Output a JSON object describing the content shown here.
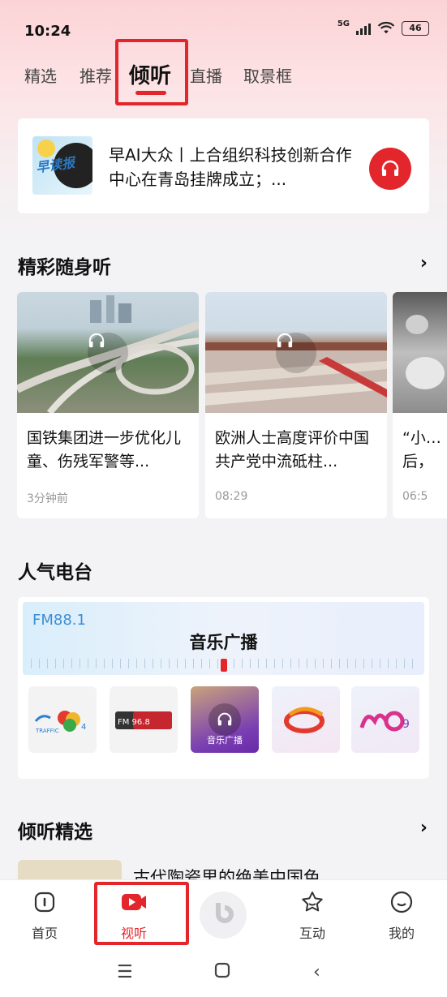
{
  "status": {
    "time": "10:24",
    "network": "5G",
    "battery": "46"
  },
  "tabs": [
    {
      "label": "精选"
    },
    {
      "label": "推荐"
    },
    {
      "label": "倾听"
    },
    {
      "label": "直播"
    },
    {
      "label": "取景框"
    }
  ],
  "now_playing": {
    "cover_text": "早读报",
    "title": "早AI大众丨上合组织科技创新合作中心在青岛挂牌成立；..."
  },
  "section_featured": {
    "title": "精彩随身听",
    "items": [
      {
        "title": "国铁集团进一步优化儿童、伤残军警等...",
        "time": "3分钟前"
      },
      {
        "title": "欧洲人士高度评价中国共产党中流砥柱...",
        "time": "08:29"
      },
      {
        "title": "“小…后，",
        "time": "06:5"
      }
    ]
  },
  "section_radio": {
    "title": "人气电台",
    "frequency": "FM88.1",
    "station_name": "音乐广播",
    "stations": [
      {
        "icon": "traffic-radio-logo"
      },
      {
        "icon": "fm-96-8-logo",
        "text": "FM 96.8"
      },
      {
        "icon": "music-radio-logo",
        "text": "音乐广播"
      },
      {
        "icon": "radio-logo-3"
      },
      {
        "icon": "radio-logo-9"
      }
    ]
  },
  "section_picks": {
    "title": "倾听精选",
    "first_item": "古代陶瓷里的绝美中国色"
  },
  "bottom_nav": [
    {
      "label": "首页",
      "icon": "home-icon"
    },
    {
      "label": "视听",
      "icon": "video-play-icon"
    },
    {
      "label": "",
      "icon": "center-logo-icon"
    },
    {
      "label": "互动",
      "icon": "star-icon"
    },
    {
      "label": "我的",
      "icon": "profile-icon"
    }
  ],
  "colors": {
    "accent": "#e3262b",
    "text": "#1a1a1a",
    "muted": "#999999"
  }
}
